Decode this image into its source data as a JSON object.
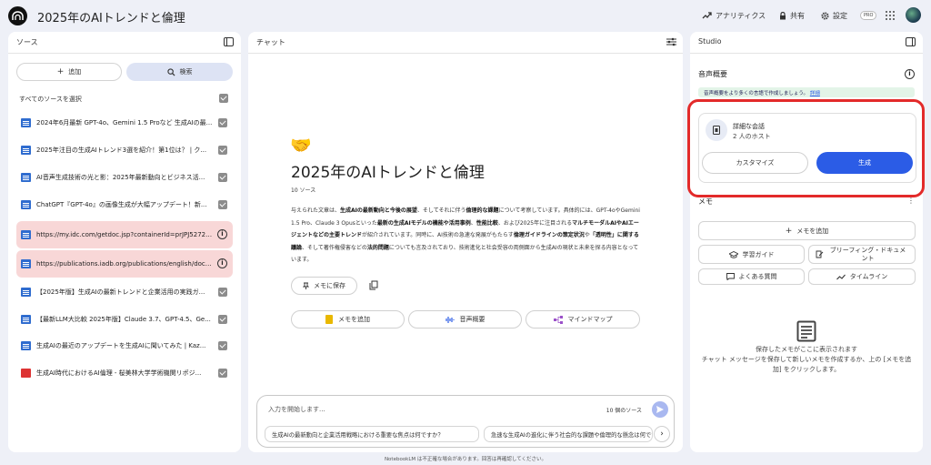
{
  "app": {
    "title": "2025年のAIトレンドと倫理"
  },
  "topbar": {
    "analytics": "アナリティクス",
    "share": "共有",
    "settings": "設定",
    "pro": "PRO"
  },
  "sources": {
    "header": "ソース",
    "add": "追加",
    "search": "検索",
    "select_all": "すべてのソースを選択",
    "items": [
      {
        "title": "2024年6月最新 GPT-4o、Gemini 1.5 Proなど 生成AIの最...",
        "type": "doc",
        "status": "checked"
      },
      {
        "title": "2025年注目の生成AIトレンド3選を紹介！第1位は？ | ク...",
        "type": "doc",
        "status": "checked"
      },
      {
        "title": "AI音声生成技術の光と影：2025年最新動向とビジネス活...",
        "type": "doc",
        "status": "checked"
      },
      {
        "title": "ChatGPT『GPT-4o』の画像生成が大幅アップデート！新...",
        "type": "doc",
        "status": "checked"
      },
      {
        "title": "https://my.idc.com/getdoc.jsp?containerId=prJPJ52722724",
        "type": "web",
        "status": "error"
      },
      {
        "title": "https://publications.iadb.org/publications/english/docum...",
        "type": "web",
        "status": "error"
      },
      {
        "title": "【2025年版】生成AIの最新トレンドと企業活用の実践ガ...",
        "type": "doc",
        "status": "checked"
      },
      {
        "title": "【最新LLM大比較 2025年版】Claude 3.7、GPT-4.5、Ge...",
        "type": "doc",
        "status": "checked"
      },
      {
        "title": "生成AIの最近のアップデートを生成AIに聞いてみた | Kaz...",
        "type": "doc",
        "status": "checked"
      },
      {
        "title": "生成AI時代におけるAI倫理 - 桜美林大学学術機関リポジ...",
        "type": "pdf",
        "status": "checked"
      }
    ]
  },
  "chat": {
    "header": "チャット",
    "emoji": "🤝",
    "title": "2025年のAIトレンドと倫理",
    "source_count": "10 ソース",
    "summary": [
      {
        "t": "与えられた文章は、",
        "b": false
      },
      {
        "t": "生成AIの最新動向と今後の展望",
        "b": true
      },
      {
        "t": "、そしてそれに伴う",
        "b": false
      },
      {
        "t": "倫理的な課題",
        "b": true
      },
      {
        "t": "について考察しています。具体的には、GPT-4oやGemini 1.5 Pro、Claude 3 Opusといった",
        "b": false
      },
      {
        "t": "最新の生成AIモデルの機能や活用事例",
        "b": true
      },
      {
        "t": "、",
        "b": false
      },
      {
        "t": "性能比較",
        "b": true
      },
      {
        "t": "、および2025年に注目される",
        "b": false
      },
      {
        "t": "マルチモーダルAIやAIエージェントなどの主要トレンド",
        "b": true
      },
      {
        "t": "が紹介されています。同時に、AI技術の急速な発展がもたらす",
        "b": false
      },
      {
        "t": "倫理ガイドラインの策定状況",
        "b": true
      },
      {
        "t": "や",
        "b": false
      },
      {
        "t": "「透明性」に関する議論",
        "b": true
      },
      {
        "t": "、そして著作権侵害などの",
        "b": false
      },
      {
        "t": "法的問題",
        "b": true
      },
      {
        "t": "についても言及されており、技術進化と社会受容の両側面から生成AIの現状と未来を探る内容となっています。",
        "b": false
      }
    ],
    "save_note": "メモに保存",
    "add_note": "メモを追加",
    "audio_overview": "音声概要",
    "mind_map": "マインドマップ",
    "input_placeholder": "入力を開始します...",
    "input_source_count": "10 個のソース",
    "suggestions": [
      "生成AIの最新動向と企業活用戦略における重要な焦点は何ですか？",
      "急速な生成AIの進化に伴う社会的な課題や倫理的な懸念は何ですか？"
    ]
  },
  "studio": {
    "header": "Studio",
    "audio_title": "音声概要",
    "banner": "音声概要をより多くの言語で作成しましょう。",
    "banner_link": "詳細",
    "card_title": "詳細な会話",
    "card_sub": "2 人のホスト",
    "customize": "カスタマイズ",
    "generate": "生成",
    "notes_title": "メモ",
    "add_note": "メモを追加",
    "study_guide": "学習ガイド",
    "briefing": "ブリーフィング・ドキュメント",
    "faq": "よくある質問",
    "timeline": "タイムライン",
    "empty_title": "保存したメモがここに表示されます",
    "empty_desc": "チャット メッセージを保存して新しいメモを作成するか、上の [メモを追加] をクリックします。"
  },
  "footer": "NotebookLM は不正確な場合があります。回答は再確認してください。",
  "colors": {
    "accent": "#2b5ce6",
    "error_bg": "#f8d7d7",
    "highlight": "#e32a2a",
    "banner_bg": "#e3f4e8"
  }
}
